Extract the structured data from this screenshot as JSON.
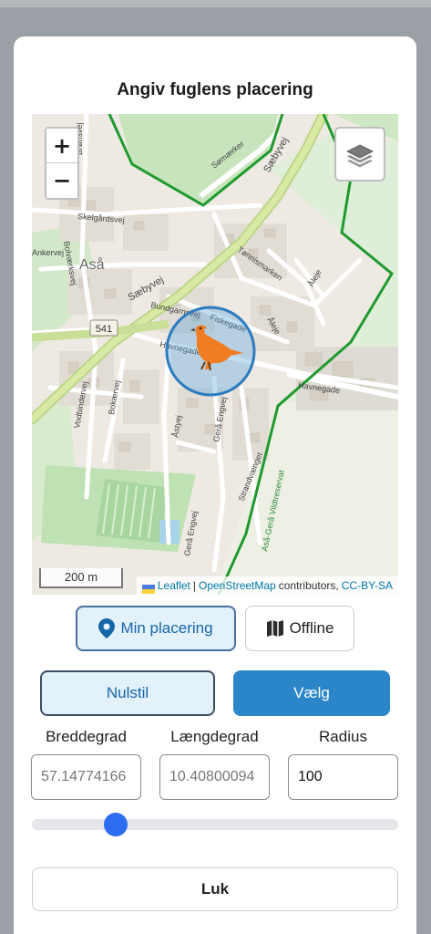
{
  "dialog": {
    "title": "Angiv fuglens placering"
  },
  "map": {
    "zoom_in": "+",
    "zoom_out": "−",
    "scale_label": "200 m",
    "attribution": {
      "leaflet": "Leaflet",
      "separator": "|",
      "osm": "OpenStreetMap",
      "contributors": "contributors,",
      "license": "CC-BY-SA"
    },
    "labels": {
      "town": "Aså",
      "road_541": "541",
      "saebyvej1": "Sæbyvej",
      "saebyvej2": "Sæbyvej",
      "samaerker": "Sømærker",
      "skelgardsvej": "Skelgårdsvej",
      "bronsvej": "Brønsvej",
      "ankervej": "Ankervej",
      "bolvaerksvej": "Bolværksvej",
      "tonnismarken": "Tønnismarken",
      "aleje": "Åleje",
      "aleje2": "Åleje",
      "bundgarnsvej": "Bundgarnsvej",
      "fiskegade": "Fiskegade",
      "havnegade1": "Havnegade",
      "havnegade2": "Havnegade",
      "vodbindervej": "Vodbindervej",
      "bokaervej": "Bokærvej",
      "astyej": "Åstyej",
      "gera_engvej1": "Gerå Engvej",
      "gera_engvej2": "Gerå Engvej",
      "strandvaenget": "Strandvænget",
      "reservat": "Aså-Gerå Vildtreservat"
    },
    "marker_icon": "bird-icon",
    "colors": {
      "reserve_border": "#1f9a2e",
      "marker_circle": "#2a7bbf",
      "bird": "#f07d21"
    }
  },
  "buttons": {
    "my_location": "Min placering",
    "offline": "Offline",
    "reset": "Nulstil",
    "choose": "Vælg",
    "close": "Luk"
  },
  "fields": {
    "latitude": {
      "label": "Breddegrad",
      "value": "57.14774166"
    },
    "longitude": {
      "label": "Længdegrad",
      "value": "10.40800094"
    },
    "radius": {
      "label": "Radius",
      "value": "100"
    }
  },
  "radius_slider": {
    "level": 0.21
  }
}
